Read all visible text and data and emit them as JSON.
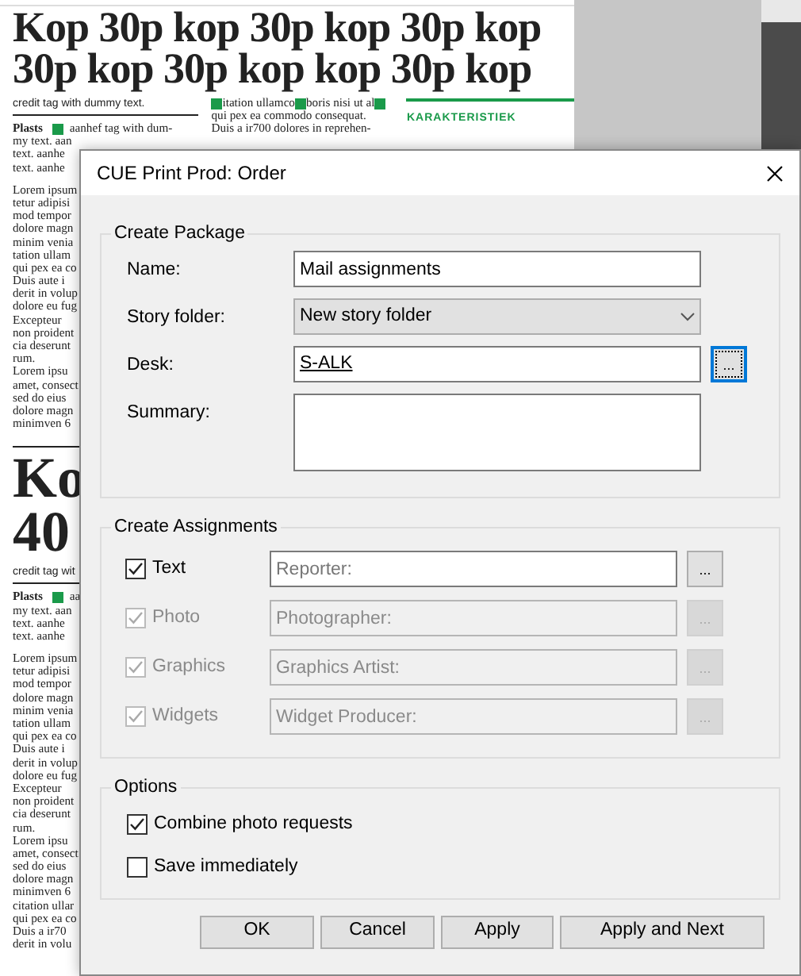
{
  "newspaper": {
    "headline_lines": [
      "Kop 30p kop 30p kop 30p kop",
      "30p kop 30p kop kop 30p kop"
    ],
    "column_1": {
      "credit": "credit tag with dummy text.",
      "lead_label": "Plasts",
      "lead_text": "aanhef tag with dum-",
      "lines": [
        "my text. aan",
        "text. aanhe",
        "text. aanhe"
      ],
      "lines_2": [
        "Lorem ipsum",
        "tetur adipisi",
        "mod tempor",
        "dolore magn",
        "minim venia",
        "tation ullam",
        "qui pex ea co",
        "Duis aute i",
        "derit in volup",
        "dolore eu fug",
        "Excepteur",
        "non proident",
        "cia deserunt",
        "rum.",
        "Lorem ipsu",
        "amet, consect",
        "sed do eius",
        "dolore magn",
        "minimven 6"
      ]
    },
    "column_2": {
      "first_line_parts": [
        "itation ullamco",
        "boris nisi ut al"
      ],
      "lines": [
        "qui pex ea commodo consequat.",
        "Duis a ir700 dolores in reprehen-"
      ]
    },
    "column_3": {
      "heading": "KARAKTERISTIEK"
    },
    "headline_2_lines": [
      "Ko",
      "40"
    ],
    "column_1b": {
      "credit": "credit tag wit",
      "lead_label": "Plasts",
      "lead_text": "aa",
      "lines": [
        "my text. aan",
        "text. aanhe",
        "text. aanhe"
      ],
      "lines_2": [
        "Lorem ipsum",
        "tetur adipisi",
        "mod tempor",
        "dolore magn",
        "minim venia",
        "tation ullam",
        "qui pex ea co",
        "Duis aute i",
        "derit in volup",
        "dolore eu fug",
        "Excepteur",
        "non proident",
        "cia deserunt",
        "rum.",
        "Lorem ipsu",
        "amet, consect",
        "sed do eius",
        "dolore magn",
        "minimven 6",
        "citation ullar",
        "qui pex ea co",
        "Duis a ir70",
        "derit in volu"
      ]
    }
  },
  "dialog": {
    "title": "CUE Print Prod: Order",
    "create_package": {
      "title": "Create Package",
      "fields": [
        {
          "kind": "text",
          "label": "Name:",
          "value": "Mail assignments"
        },
        {
          "kind": "select",
          "label": "Story folder:",
          "value": "New story folder"
        },
        {
          "kind": "link",
          "label": "Desk:",
          "value": "S-ALK",
          "browse": "...",
          "focused": true
        },
        {
          "kind": "textarea",
          "label": "Summary:"
        }
      ]
    },
    "create_assignments": {
      "title": "Create Assignments",
      "rows": [
        {
          "label": "Text",
          "checked": true,
          "disabled": false,
          "placeholder": "Reporter:",
          "browse": "..."
        },
        {
          "label": "Photo",
          "checked": true,
          "disabled": true,
          "placeholder": "Photographer:",
          "browse": "..."
        },
        {
          "label": "Graphics",
          "checked": true,
          "disabled": true,
          "placeholder": "Graphics Artist:",
          "browse": "..."
        },
        {
          "label": "Widgets",
          "checked": true,
          "disabled": true,
          "placeholder": "Widget Producer:",
          "browse": "..."
        }
      ]
    },
    "options": {
      "title": "Options",
      "items": [
        {
          "label": "Combine photo requests",
          "checked": true
        },
        {
          "label": "Save immediately",
          "checked": false
        }
      ]
    },
    "buttons": [
      "OK",
      "Cancel",
      "Apply",
      "Apply and Next"
    ]
  }
}
